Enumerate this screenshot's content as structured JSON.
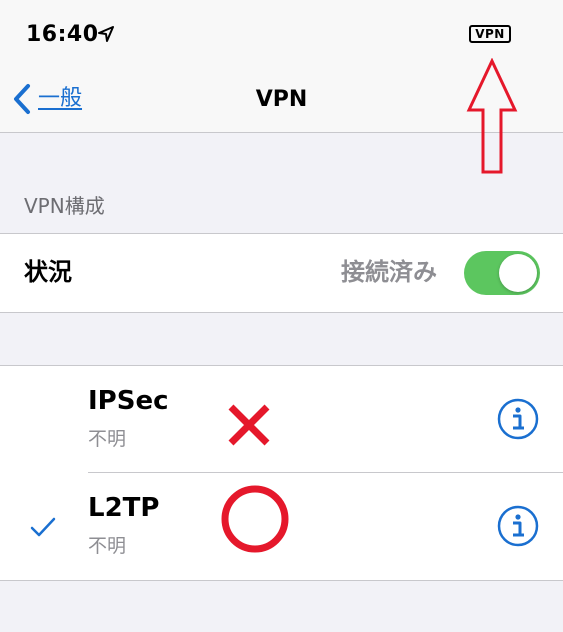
{
  "status_bar": {
    "time": "16:40",
    "location_icon": "location-arrow-icon",
    "vpn_badge": "VPN"
  },
  "nav": {
    "back_label": "一般",
    "back_icon": "chevron-left-icon",
    "title": "VPN"
  },
  "section": {
    "header": "VPN構成"
  },
  "status_row": {
    "label": "状況",
    "value": "接続済み",
    "toggle_on": true
  },
  "vpn_configs": [
    {
      "name": "IPSec",
      "status": "不明",
      "selected": false
    },
    {
      "name": "L2TP",
      "status": "不明",
      "selected": true
    }
  ],
  "colors": {
    "accent": "#1a6fd0",
    "toggle_on": "#5cc65f",
    "annotation_red": "#e5182b",
    "secondary_text": "#8e8e93",
    "background": "#f2f2f7"
  },
  "annotations": {
    "arrow": "up-arrow-annotation",
    "wrong_mark": "cross-mark",
    "correct_mark": "circle-mark"
  }
}
